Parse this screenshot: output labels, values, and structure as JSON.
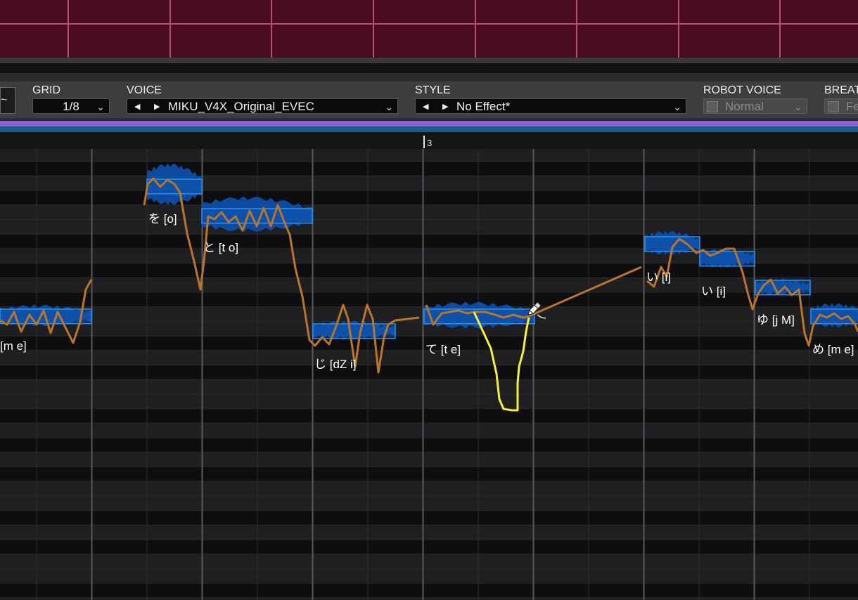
{
  "toolbar": {
    "grid": {
      "label": "GRID",
      "value": "1/8"
    },
    "voice": {
      "label": "VOICE",
      "value": "MIKU_V4X_Original_EVEC",
      "prev_icon": "triangle-left-icon",
      "next_icon": "triangle-right-icon"
    },
    "style": {
      "label": "STYLE",
      "value": "No Effect*",
      "prev_icon": "triangle-left-icon",
      "next_icon": "triangle-right-icon"
    },
    "robot_voice": {
      "label": "ROBOT VOICE",
      "value": "Normal",
      "enabled": false
    },
    "breath": {
      "label": "BREAT",
      "value": "Fe",
      "enabled": false
    },
    "left_icon": "curve-tool-icon"
  },
  "ruler": {
    "measure_label": "3"
  },
  "notes": [
    {
      "lyric": "[m e]"
    },
    {
      "lyric": "を [o]"
    },
    {
      "lyric": "と [t o]"
    },
    {
      "lyric": "じ [dZ i]"
    },
    {
      "lyric": "て [t e]"
    },
    {
      "lyric": "い [i]"
    },
    {
      "lyric": "い [i]"
    },
    {
      "lyric": "ゆ [j M]"
    },
    {
      "lyric": "め [m e]"
    }
  ],
  "cursor_icon": "pencil-icon",
  "colors": {
    "track_bg": "#4a0a1f",
    "note_fill": "#0d4fa8",
    "note_border": "#2f8fe8",
    "pitch_curve": "#b9762a",
    "drawn_curve": "#f6f03a",
    "accent_purple": "#8e5fcf",
    "accent_blue": "#1c5d8e"
  }
}
